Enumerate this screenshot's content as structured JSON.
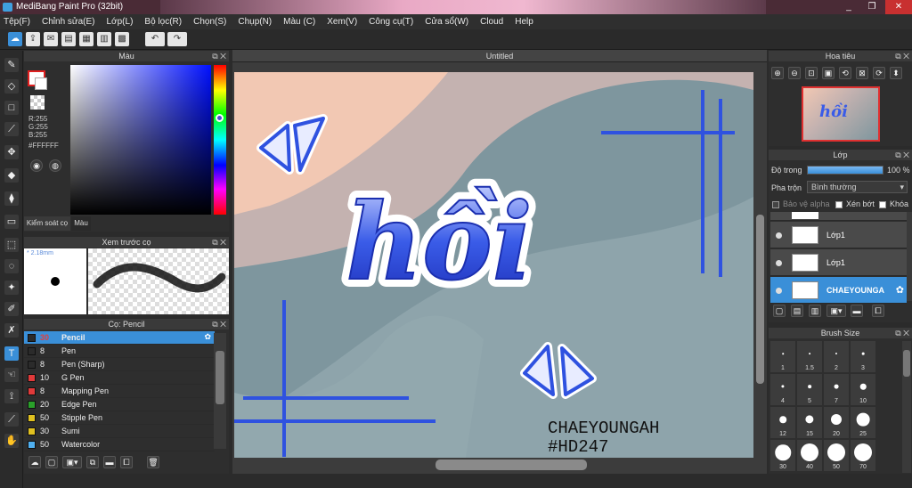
{
  "window": {
    "title": "MediBang Paint Pro (32bit)",
    "minimize": "_",
    "maximize": "❐",
    "close": "✕"
  },
  "menu": [
    "Tệp(F)",
    "Chỉnh sửa(E)",
    "Lớp(L)",
    "Bộ lọc(R)",
    "Chọn(S)",
    "Chụp(N)",
    "Màu (C)",
    "Xem(V)",
    "Công cụ(T)",
    "Cửa sổ(W)",
    "Cloud",
    "Help"
  ],
  "color_panel": {
    "title": "Màu",
    "r": "R:255",
    "g": "G:255",
    "b": "B:255",
    "hex": "#FFFFFF",
    "tab_control": "Kiểm soát cọ",
    "tab_color": "Màu"
  },
  "brush_preview": {
    "title": "Xem trước cọ",
    "size": "* 2.18mm"
  },
  "brush_list": {
    "title": "Cọ: Pencil",
    "items": [
      {
        "size": "30",
        "name": "Pencil",
        "color": "#2b2b2b",
        "selected": true
      },
      {
        "size": "8",
        "name": "Pen",
        "color": "#2b2b2b"
      },
      {
        "size": "8",
        "name": "Pen (Sharp)",
        "color": "#2b2b2b"
      },
      {
        "size": "10",
        "name": "G Pen",
        "color": "#e03a3a"
      },
      {
        "size": "8",
        "name": "Mapping Pen",
        "color": "#e03a3a"
      },
      {
        "size": "20",
        "name": "Edge Pen",
        "color": "#2aa02a"
      },
      {
        "size": "50",
        "name": "Stipple Pen",
        "color": "#e0c020"
      },
      {
        "size": "30",
        "name": "Sumi",
        "color": "#e0c020"
      },
      {
        "size": "50",
        "name": "Watercolor",
        "color": "#50b0f0"
      }
    ]
  },
  "canvas": {
    "doc_title": "Untitled",
    "art_word": "hồi",
    "signature1": "CHAEYOUNGAH",
    "signature2": "#HD247"
  },
  "navigator": {
    "title": "Hoa tiêu"
  },
  "layers": {
    "title": "Lớp",
    "opacity_label": "Độ trong",
    "opacity_value": "100 %",
    "blend_label": "Pha trộn",
    "blend_value": "Bình thường",
    "alpha_protect": "Bảo vệ alpha",
    "clipping": "Xén bớt",
    "lock": "Khóa",
    "items": [
      {
        "name": "Lớp1",
        "selected": false
      },
      {
        "name": "Lớp1",
        "selected": false
      },
      {
        "name": "CHAEYOUNGA",
        "selected": true
      }
    ]
  },
  "brush_size": {
    "title": "Brush Size",
    "sizes": [
      "1",
      "1.5",
      "2",
      "3",
      "4",
      "5",
      "7",
      "10",
      "12",
      "15",
      "20",
      "25",
      "30",
      "40",
      "50",
      "70"
    ]
  },
  "colors": {
    "accent": "#3a8fd8",
    "art_blue": "#2f52e0",
    "sky": "#f2c6b2",
    "bg_mauve": "#c9b9b9",
    "teal": "#7d97a0",
    "dark_teal": "#8aa0aa"
  }
}
